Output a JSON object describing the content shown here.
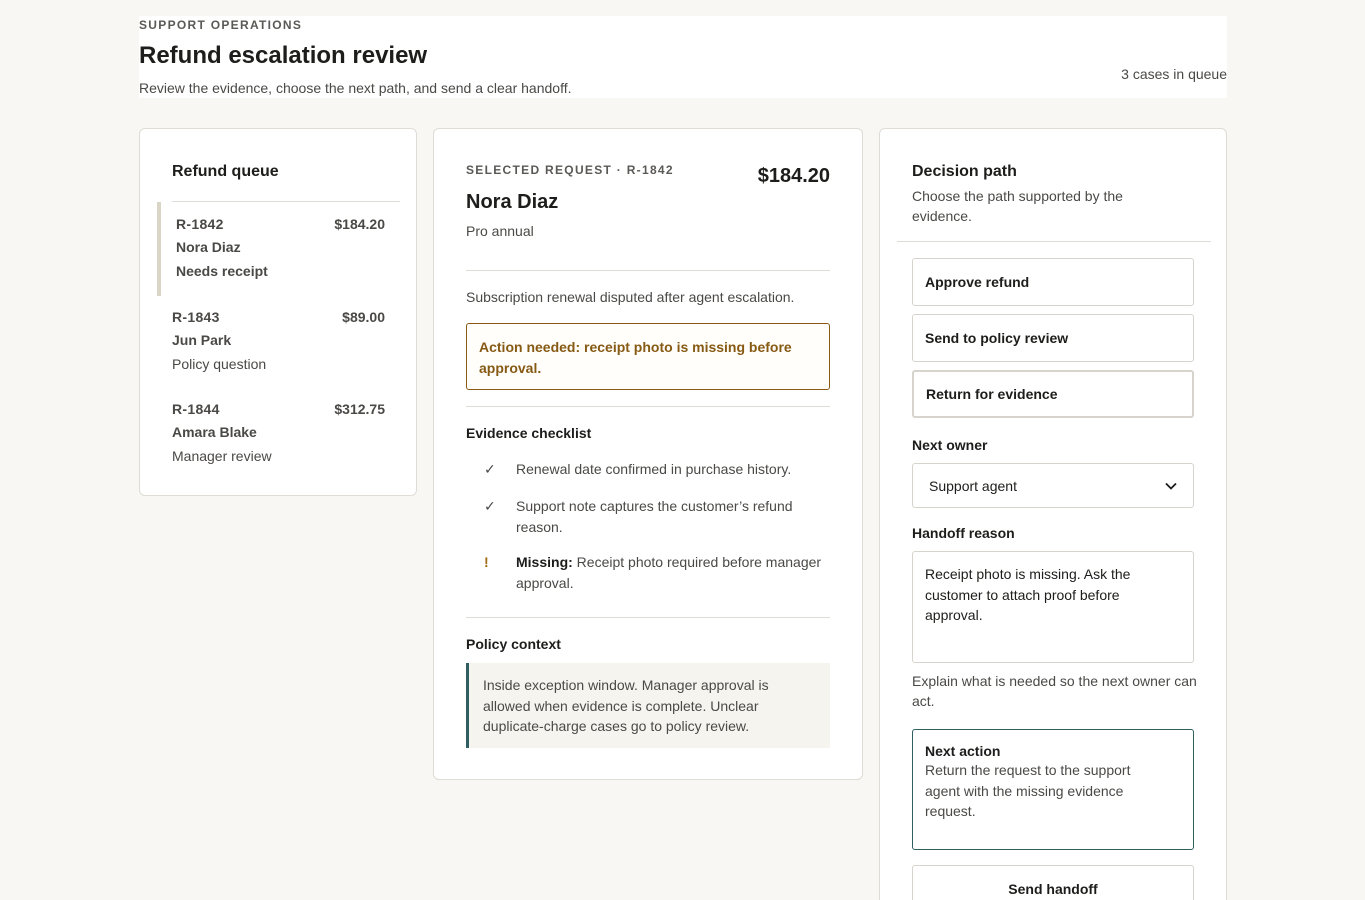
{
  "header": {
    "eyebrow": "SUPPORT OPERATIONS",
    "title": "Refund escalation review",
    "subtitle": "Review the evidence, choose the next path, and send a clear handoff.",
    "queue_count": "3 cases in queue"
  },
  "queue": {
    "title": "Refund queue",
    "items": [
      {
        "id": "R-1842",
        "amount": "$184.20",
        "name": "Nora Diaz",
        "status": "Needs receipt",
        "selected": true
      },
      {
        "id": "R-1843",
        "amount": "$89.00",
        "name": "Jun Park",
        "status": "Policy question",
        "selected": false
      },
      {
        "id": "R-1844",
        "amount": "$312.75",
        "name": "Amara Blake",
        "status": "Manager review",
        "selected": false
      }
    ]
  },
  "detail": {
    "selected_label": "SELECTED REQUEST · R-1842",
    "amount": "$184.20",
    "name": "Nora Diaz",
    "plan": "Pro annual",
    "summary": "Subscription renewal disputed after agent escalation.",
    "alert": "Action needed: receipt photo is missing before approval.",
    "checklist_title": "Evidence checklist",
    "checklist": [
      {
        "mark": "✓",
        "text": "Renewal date confirmed in purchase history."
      },
      {
        "mark": "✓",
        "text": "Support note captures the customer’s refund reason."
      }
    ],
    "missing": {
      "mark": "!",
      "label": "Missing:",
      "text": "Receipt photo required before manager approval."
    },
    "policy_title": "Policy context",
    "policy_text": "Inside exception window. Manager approval is allowed when evidence is complete. Unclear duplicate-charge cases go to policy review."
  },
  "decision": {
    "title": "Decision path",
    "subtitle": "Choose the path supported by the evidence.",
    "paths": [
      {
        "label": "Approve refund"
      },
      {
        "label": "Send to policy review"
      },
      {
        "label": "Return for evidence"
      }
    ],
    "selected_path": "Return for evidence",
    "next_owner_label": "Next owner",
    "next_owner_value": "Support agent",
    "handoff_label": "Handoff reason",
    "handoff_value": "Receipt photo is missing. Ask the customer to attach proof before approval.",
    "hint": "Explain what is needed so the next owner can act.",
    "next_action_title": "Next action",
    "next_action_text": "Return the request to the support agent with the missing evidence request.",
    "send_label": "Send handoff"
  },
  "colors": {
    "background": "#f8f7f3",
    "warning": "#875a14",
    "accent_teal": "#2f5e62",
    "selected_queue_bar": "#d9d5c7"
  }
}
